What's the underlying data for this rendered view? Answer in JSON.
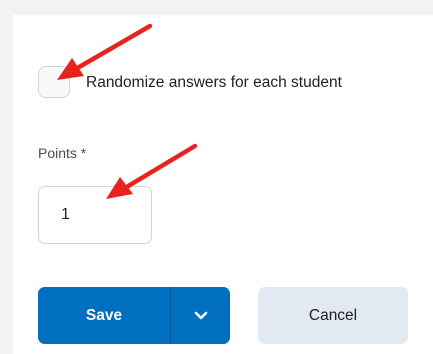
{
  "form": {
    "randomize_label": "Randomize answers for each student",
    "randomize_checked": false,
    "points_label": "Points *",
    "points_value": "1"
  },
  "actions": {
    "save_label": "Save",
    "dropdown_icon": "chevron-down-icon",
    "cancel_label": "Cancel"
  },
  "annotations": {
    "arrow_icon": "red-arrow-annotation",
    "arrow_color": "#e8231f"
  },
  "colors": {
    "primary": "#006fbf",
    "secondary_button": "#e3e9f1",
    "background": "#f3f3f3"
  }
}
